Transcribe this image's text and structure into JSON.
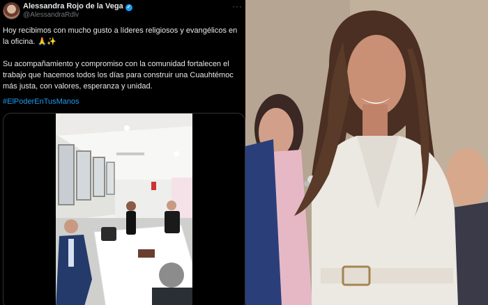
{
  "tweet": {
    "author_name": "Alessandra Rojo de la Vega",
    "handle": "@AlessandraRdlv",
    "more_label": "···",
    "paragraph_1": "Hoy recibimos con mucho gusto a líderes religiosos y evangélicos en la oficina. 🙏✨",
    "paragraph_2": "Su acompañamiento y compromiso con la comunidad fortalecen el trabajo que hacemos todos los días para construir una Cuauhtémoc más justa, con valores, esperanza y unidad.",
    "hashtag": "#ElPoderEnTusManos",
    "verified_badge": "✓"
  },
  "colors": {
    "background": "#000000",
    "text": "#e7e9ea",
    "secondary_text": "#71767b",
    "link": "#1d9bf0",
    "verified": "#1d9bf0"
  },
  "icons": [
    "avatar",
    "verified-badge-icon",
    "more-options-icon"
  ]
}
